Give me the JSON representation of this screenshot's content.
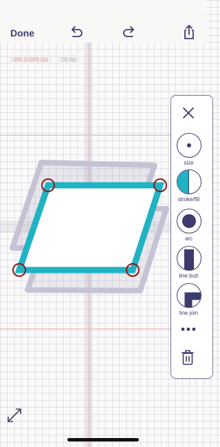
{
  "toolbar": {
    "done_label": "Done",
    "undo_icon": "undo-icon",
    "redo_icon": "redo-icon",
    "share_icon": "share-icon"
  },
  "info": {
    "size": "369.2x369.2pt",
    "stroke": "28.4pt"
  },
  "panel": {
    "close_icon": "close-icon",
    "items": [
      {
        "label": "size",
        "icon": "size-dot-icon"
      },
      {
        "label": "stroke/fill",
        "icon": "half-circle-icon"
      },
      {
        "label": "arc",
        "icon": "filled-circle-icon"
      },
      {
        "label": "line butt",
        "icon": "line-butt-icon"
      },
      {
        "label": "line join",
        "icon": "line-join-icon"
      }
    ],
    "more_icon": "more-icon",
    "delete_icon": "trash-icon"
  },
  "expand_icon": "expand-icon",
  "colors": {
    "accent": "#1fb3c4",
    "ink": "#3d3a6e",
    "handle": "#8b1a1a",
    "guide": "#f0b3b0"
  }
}
